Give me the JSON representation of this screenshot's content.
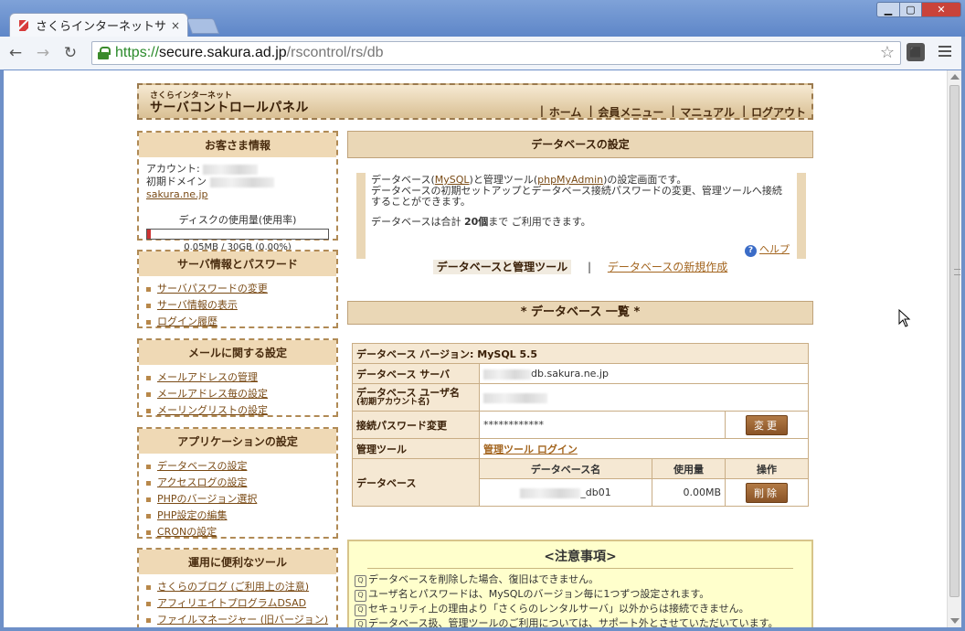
{
  "browser": {
    "tab_title": "さくらインターネットサ",
    "tab_close": "×",
    "url_scheme": "https://",
    "url_host": "secure.sakura.ad.jp",
    "url_path": "/rscontrol/rs/db",
    "win_min": "▭",
    "win_max": "▭",
    "win_close": "✕"
  },
  "header": {
    "logo_small": "さくらインターネット",
    "logo_big": "サーバコントロールパネル",
    "nav": [
      "ホーム",
      "会員メニュー",
      "マニュアル",
      "ログアウト"
    ]
  },
  "customer": {
    "title": "お客さま情報",
    "account_label": "アカウント:",
    "domain_label": "初期ドメイン",
    "domain_suffix": "sakura.ne.jp",
    "disk_label": "ディスクの使用量(使用率)",
    "disk_value": "0.05MB / 30GB (0.00%)",
    "disk_ratio": 0.0
  },
  "sidebar": [
    {
      "title": "サーバ情報とパスワード",
      "items": [
        "サーバパスワードの変更",
        "サーバ情報の表示",
        "ログイン履歴"
      ]
    },
    {
      "title": "メールに関する設定",
      "items": [
        "メールアドレスの管理",
        "メールアドレス毎の設定",
        "メーリングリストの設定"
      ]
    },
    {
      "title": "アプリケーションの設定",
      "items": [
        "データベースの設定",
        "アクセスログの設定",
        "PHPのバージョン選択",
        "PHP設定の編集",
        "CRONの設定"
      ]
    },
    {
      "title": "運用に便利なツール",
      "items": [
        "さくらのブログ (ご利用上の注意)",
        "アフィリエイトプログラムDSAD",
        "ファイルマネージャー (旧バージョン)"
      ]
    }
  ],
  "main": {
    "title": "データベースの設定",
    "desc_pre": "データベース(",
    "desc_mysql": "MySQL",
    "desc_mid": ")と管理ツール(",
    "desc_pma": "phpMyAdmin",
    "desc_post": ")の設定画面です。",
    "desc_line2": "データベースの初期セットアップとデータベース接続パスワードの変更、管理ツールへ接続することができます。",
    "desc_total_pre": "データベースは合計 ",
    "desc_total_num": "20個",
    "desc_total_post": "まで ご利用できます。",
    "help": "ヘルプ",
    "subnav_current": "データベースと管理ツール",
    "subnav_sep": "|",
    "subnav_new": "データベースの新規作成",
    "list_title": "* データベース 一覧 *"
  },
  "db_table": {
    "version_label": "データベース バージョン: MySQL 5.5",
    "server_label": "データベース サーバ",
    "server_value": "db.sakura.ne.jp",
    "user_label": "データベース ユーザ名",
    "user_sub": "(初期アカウント名)",
    "pw_label": "接続パスワード変更",
    "pw_value": "************",
    "pw_button": "変更",
    "tool_label": "管理ツール",
    "tool_link": "管理ツール ログイン",
    "db_label": "データベース",
    "col_name": "データベース名",
    "col_usage": "使用量",
    "col_action": "操作",
    "db_name": "_db01",
    "db_usage": "0.00MB",
    "delete_button": "削除"
  },
  "notice": {
    "title": "<注意事項>",
    "items": [
      "データベースを削除した場合、復旧はできません。",
      "ユーザ名とパスワードは、MySQLのバージョン毎に1つずつ設定されます。",
      "セキュリティ上の理由より「さくらのレンタルサーバ」以外からは接続できません。",
      "データベース扱、管理ツールのご利用については、サポート外とさせていただいています。"
    ]
  }
}
